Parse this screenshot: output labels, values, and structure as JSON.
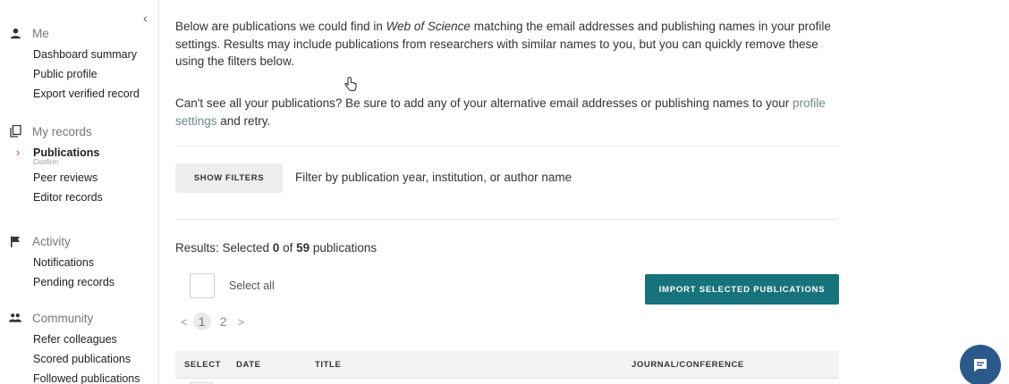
{
  "sidebar": {
    "collapse_icon": "chevron-left-icon",
    "me": {
      "heading": "Me",
      "icon": "person-icon",
      "items": [
        "Dashboard summary",
        "Public profile",
        "Export verified record"
      ]
    },
    "records": {
      "heading": "My records",
      "icon": "copy-icon",
      "items": [
        "Publications",
        "Peer reviews",
        "Editor records"
      ],
      "active_subtext": "Confirm"
    },
    "activity": {
      "heading": "Activity",
      "icon": "flag-icon",
      "items": [
        "Notifications",
        "Pending records"
      ]
    },
    "community": {
      "heading": "Community",
      "icon": "group-icon",
      "items": [
        "Refer colleagues",
        "Scored publications",
        "Followed publications"
      ]
    }
  },
  "main": {
    "intro_part1": "Below are publications we could find in ",
    "intro_source": "Web of Science",
    "intro_part2": " matching the email addresses and publishing names in your profile settings. Results may include publications from researchers with similar names to you, but you can quickly remove these using the filters below.",
    "help_part1": "Can't see all your publications? Be sure to add any of your alternative email addresses or publishing names to your ",
    "help_link": "profile settings",
    "help_part2": " and retry.",
    "show_filters": "SHOW FILTERS",
    "filter_description": "Filter by publication year, institution, or author name",
    "results_prefix": "Results: Selected ",
    "selected_count": "0",
    "results_of": " of ",
    "total_count": "59",
    "results_suffix": " publications",
    "select_all": "Select all",
    "import_button": "IMPORT SELECTED PUBLICATIONS",
    "pagination": {
      "prev": "<",
      "pages": [
        "1",
        "2"
      ],
      "current": "1",
      "next": ">"
    },
    "table_columns": [
      "SELECT",
      "DATE",
      "TITLE",
      "JOURNAL/CONFERENCE"
    ]
  },
  "chat": {
    "icon": "chat-icon"
  },
  "colors": {
    "accent": "#17737b",
    "active_chevron": "#c0501f",
    "chat": "#2a5a8a",
    "link": "#6a8a8f"
  }
}
